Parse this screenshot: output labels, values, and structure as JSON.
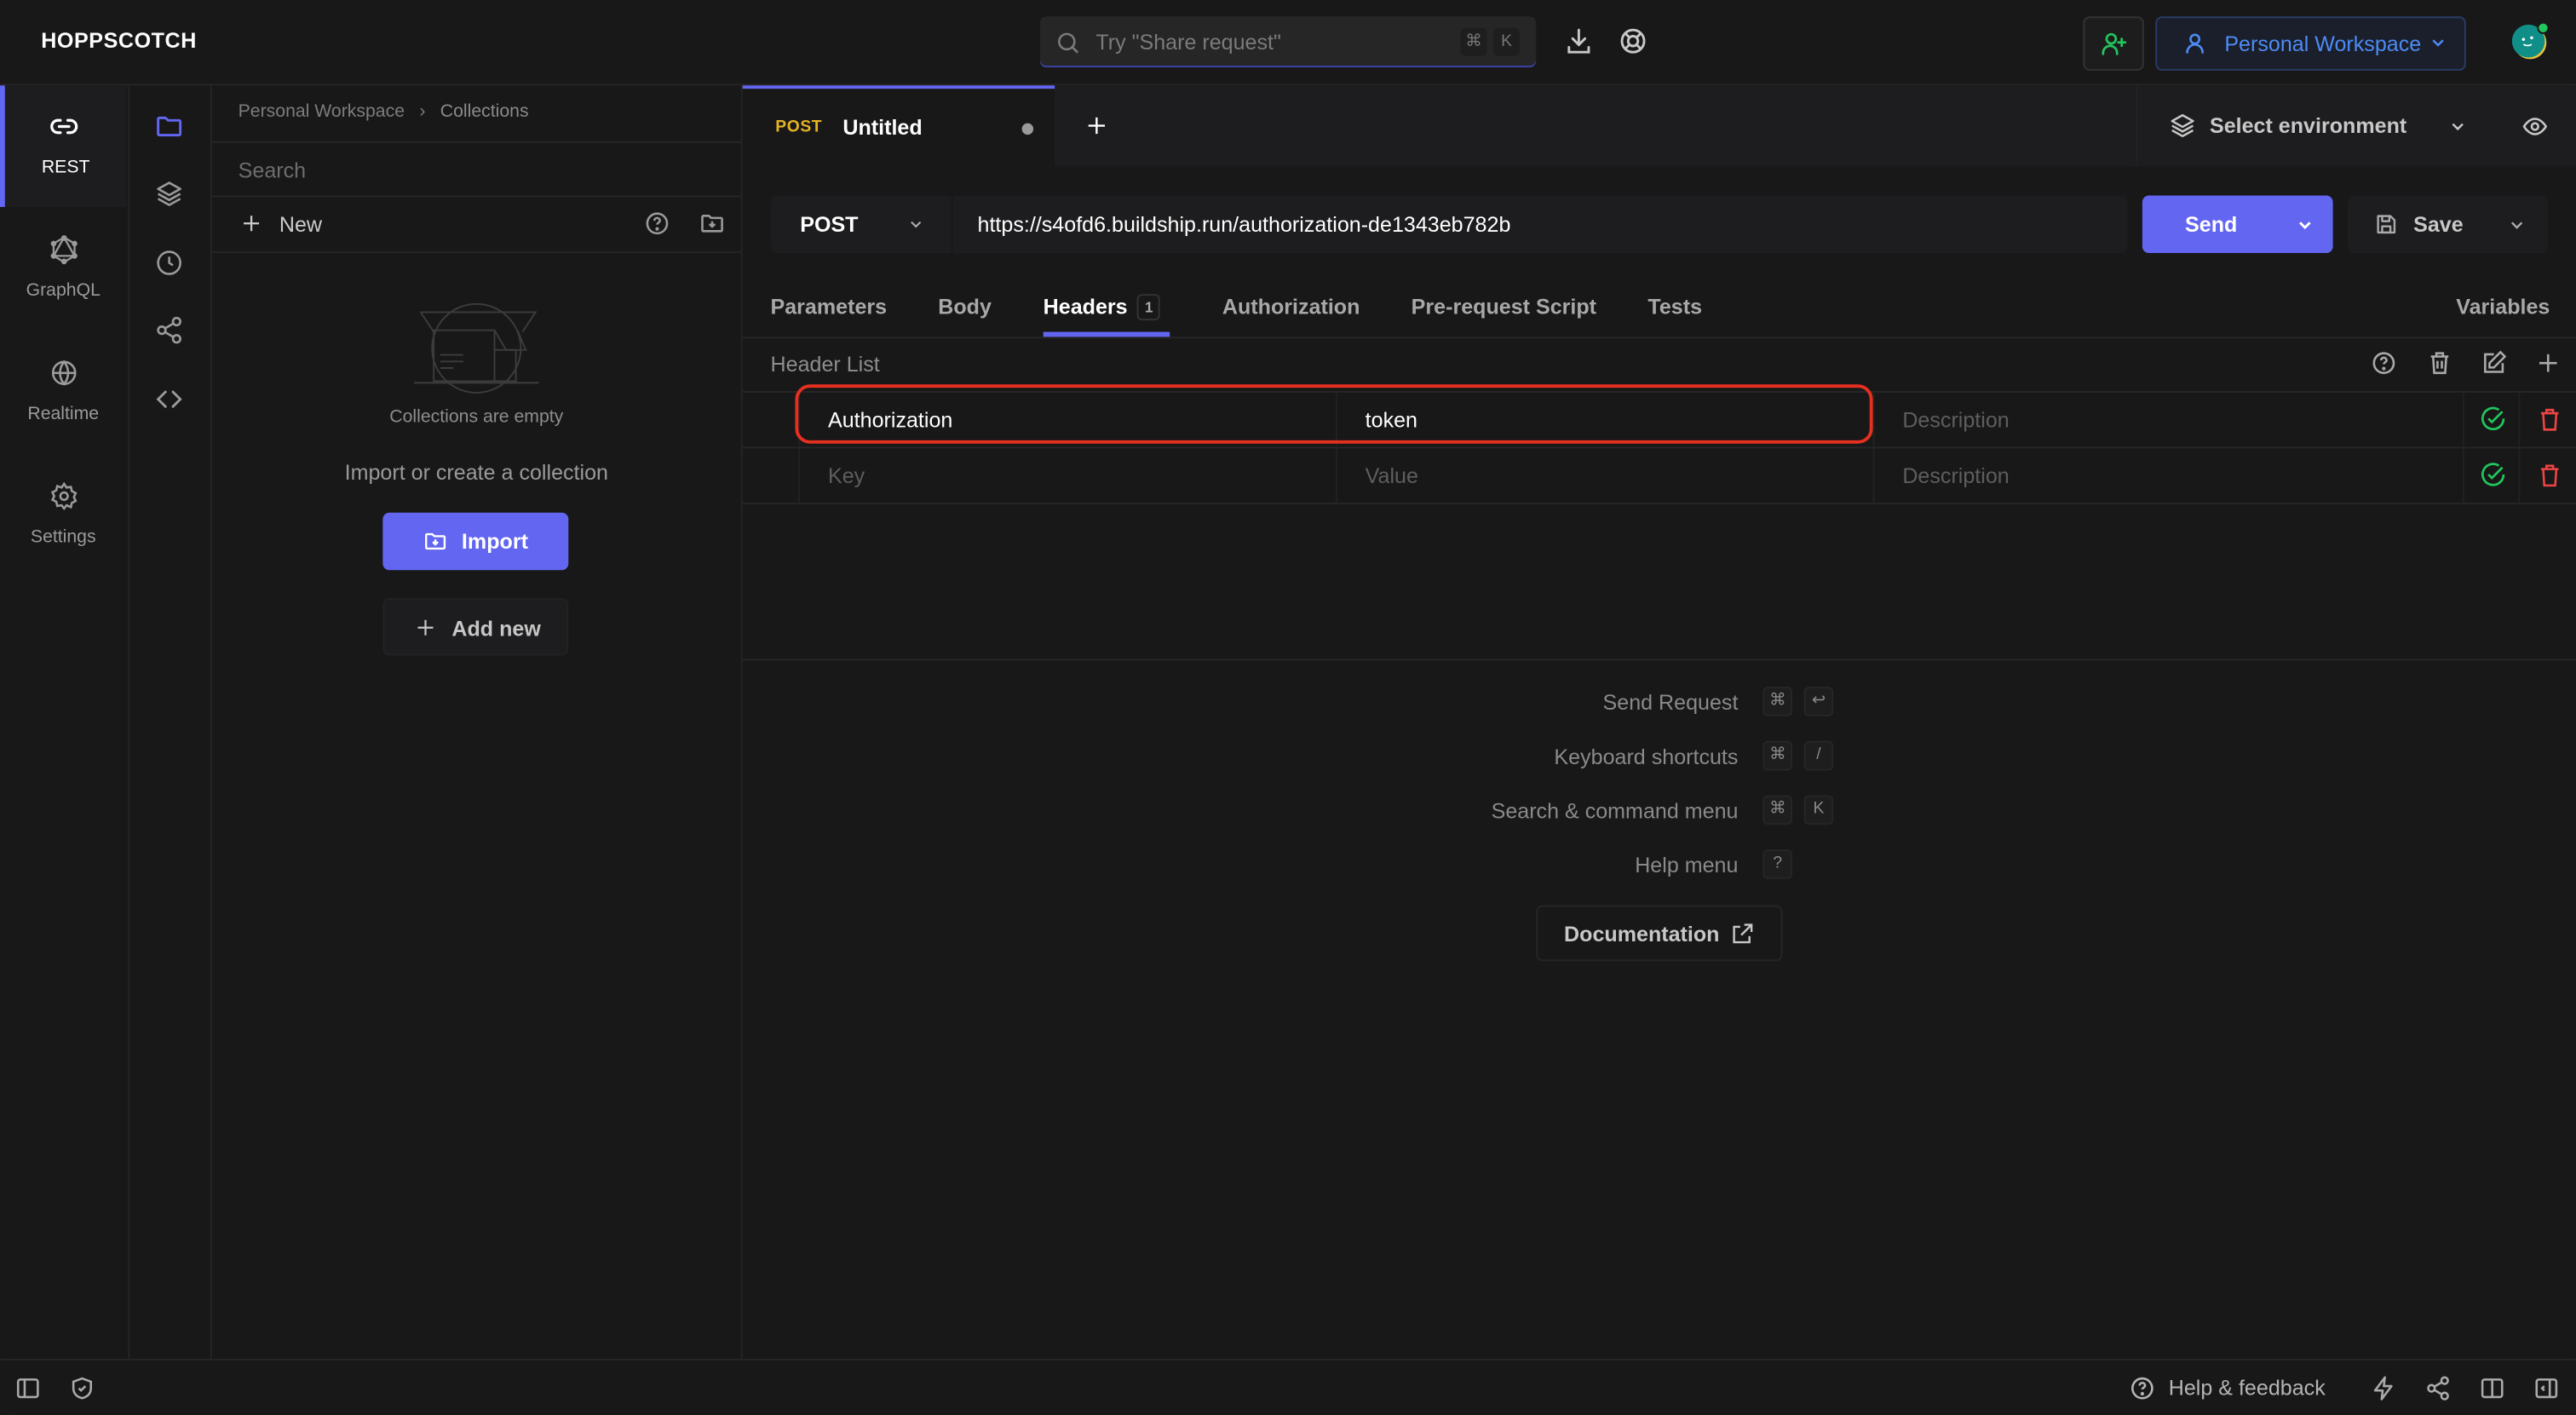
{
  "app": {
    "name": "HOPPSCOTCH",
    "search_placeholder": "Try \"Share request\"",
    "search_keys": [
      "⌘",
      "K"
    ],
    "workspace_label": "Personal Workspace",
    "accent_color": "#6366f1"
  },
  "rail": {
    "items": [
      {
        "label": "REST",
        "icon": "link-icon",
        "active": true
      },
      {
        "label": "GraphQL",
        "icon": "graphql-icon",
        "active": false
      },
      {
        "label": "Realtime",
        "icon": "globe-icon",
        "active": false
      },
      {
        "label": "Settings",
        "icon": "gear-icon",
        "active": false
      }
    ]
  },
  "subrail": {
    "items": [
      "folder-icon",
      "layers-icon",
      "clock-icon",
      "share-icon",
      "code-icon"
    ]
  },
  "collections": {
    "breadcrumb": [
      "Personal Workspace",
      "Collections"
    ],
    "search_placeholder": "Search",
    "new_label": "New",
    "empty_title": "Collections are empty",
    "empty_subtitle": "Import or create a collection",
    "import_label": "Import",
    "add_new_label": "Add new"
  },
  "request_tab": {
    "method": "POST",
    "title": "Untitled",
    "unsaved": true
  },
  "environment": {
    "label": "Select environment"
  },
  "request": {
    "method": "POST",
    "url": "https://s4ofd6.buildship.run/authorization-de1343eb782b",
    "send_label": "Send",
    "save_label": "Save"
  },
  "subtabs": {
    "items": [
      {
        "label": "Parameters",
        "active": false
      },
      {
        "label": "Body",
        "active": false
      },
      {
        "label": "Headers",
        "active": true,
        "badge": "1"
      },
      {
        "label": "Authorization",
        "active": false
      },
      {
        "label": "Pre-request Script",
        "active": false
      },
      {
        "label": "Tests",
        "active": false
      }
    ],
    "variables_label": "Variables"
  },
  "headers": {
    "title": "Header List",
    "rows": [
      {
        "key": "Authorization",
        "value": "token",
        "description": "",
        "description_placeholder": "Description",
        "enabled": true
      },
      {
        "key": "",
        "key_placeholder": "Key",
        "value": "",
        "value_placeholder": "Value",
        "description": "",
        "description_placeholder": "Description",
        "enabled": true
      }
    ]
  },
  "shortcuts": {
    "items": [
      {
        "label": "Send Request",
        "keys": [
          "⌘",
          "↩"
        ]
      },
      {
        "label": "Keyboard shortcuts",
        "keys": [
          "⌘",
          "/"
        ]
      },
      {
        "label": "Search & command menu",
        "keys": [
          "⌘",
          "K"
        ]
      },
      {
        "label": "Help menu",
        "keys": [
          "?"
        ]
      }
    ],
    "documentation_label": "Documentation"
  },
  "footer": {
    "help_label": "Help & feedback"
  }
}
